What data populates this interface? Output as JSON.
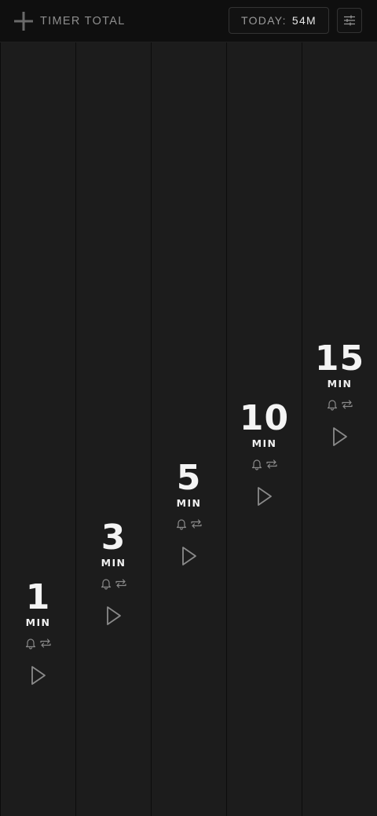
{
  "header": {
    "brand_label": "TIMER TOTAL",
    "today_label": "TODAY:",
    "today_value": "54M",
    "icons": {
      "add": "plus-icon",
      "settings": "sliders-icon"
    }
  },
  "timers": [
    {
      "value": "1",
      "unit": "MIN"
    },
    {
      "value": "3",
      "unit": "MIN"
    },
    {
      "value": "5",
      "unit": "MIN"
    },
    {
      "value": "10",
      "unit": "MIN"
    },
    {
      "value": "15",
      "unit": "MIN"
    }
  ],
  "timer_icons": [
    "bell-icon",
    "repeat-icon",
    "play-icon"
  ],
  "colors": {
    "background": "#141414",
    "column": "#1c1c1c",
    "text": "#f4f4f4",
    "muted": "#8e8e8e",
    "icon": "#8a8a8a"
  }
}
